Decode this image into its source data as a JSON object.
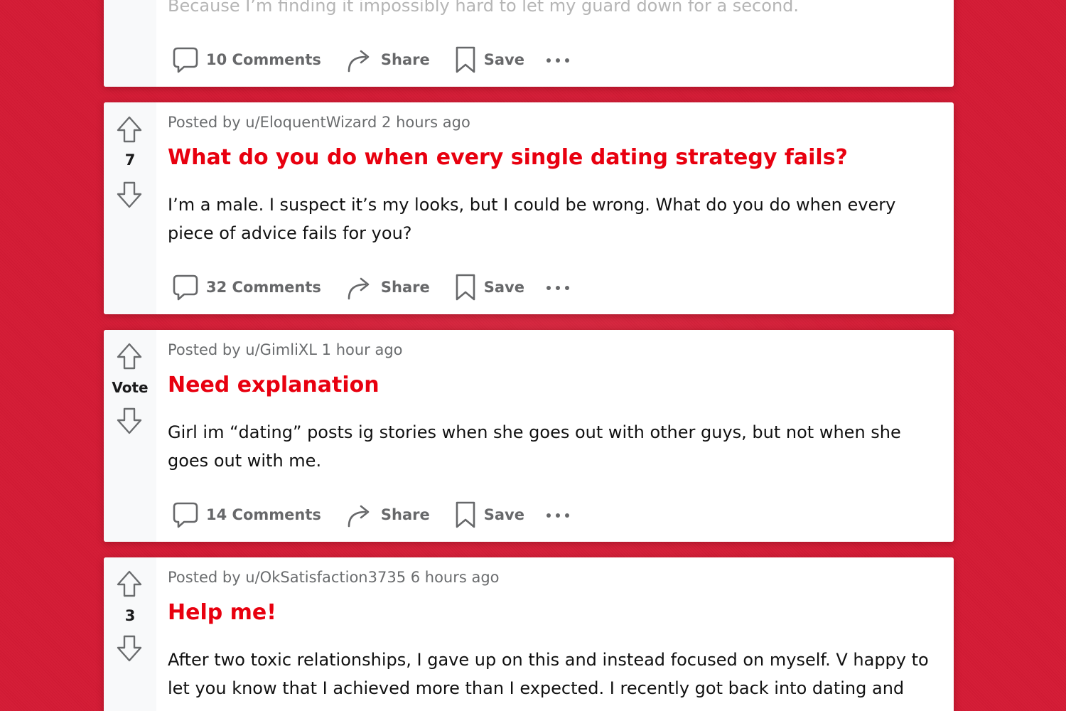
{
  "posts": [
    {
      "body_partial": "Because I’m finding it impossibly hard to let my guard down for a second.",
      "actions": {
        "comments": "10 Comments",
        "share": "Share",
        "save": "Save"
      }
    },
    {
      "meta": "Posted by u/EloquentWizard 2 hours ago",
      "vote": "7",
      "title": "What do you do when every single dating strategy fails?",
      "body_line1": "I’m a male. I suspect it’s my looks, but I could be wrong. What do you do when every",
      "body_line2": "piece of advice fails for you?",
      "actions": {
        "comments": "32 Comments",
        "share": "Share",
        "save": "Save"
      }
    },
    {
      "meta": "Posted by u/GimliXL 1 hour ago",
      "vote": "Vote",
      "title": "Need explanation",
      "body_line1": "Girl im “dating” posts ig stories when she goes out with other guys, but not when she",
      "body_line2": "goes out with me.",
      "actions": {
        "comments": "14 Comments",
        "share": "Share",
        "save": "Save"
      }
    },
    {
      "meta": "Posted by u/OkSatisfaction3735 6 hours ago",
      "vote": "3",
      "title": "Help me!",
      "body_line1": "After two toxic relationships, I gave up on this and instead focused on myself. V happy to",
      "body_line2": "let you know that I achieved more than I expected. I recently got back into dating and"
    }
  ],
  "colors": {
    "background": "#d41a34",
    "title": "#e8000f",
    "meta": "#6a6c6e",
    "action": "#67686a"
  },
  "icons": [
    "upvote-arrow-icon",
    "downvote-arrow-icon",
    "comment-bubble-icon",
    "share-arrow-icon",
    "bookmark-icon",
    "more-dots-icon"
  ]
}
